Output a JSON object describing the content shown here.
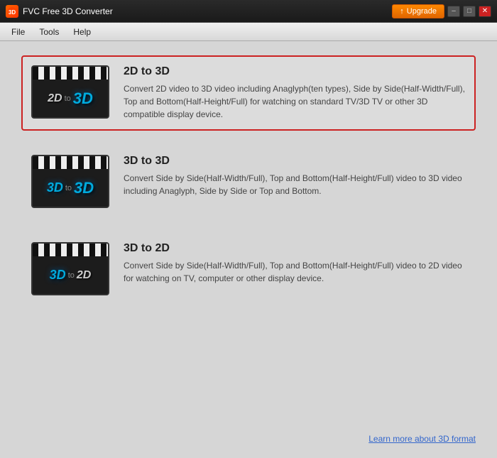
{
  "titleBar": {
    "appName": "FVC Free 3D Converter",
    "upgradeLabel": "Upgrade",
    "minBtn": "–",
    "maxBtn": "□",
    "closeBtn": "✕"
  },
  "menuBar": {
    "items": [
      "File",
      "Tools",
      "Help"
    ]
  },
  "options": [
    {
      "id": "2d-to-3d",
      "title": "2D to 3D",
      "description": "Convert 2D video to 3D video including Anaglyph(ten types), Side by Side(Half-Width/Full), Top and Bottom(Half-Height/Full) for watching on standard TV/3D TV or other 3D compatible display device.",
      "fromLabel": "2D",
      "toLabel": "3D",
      "selected": true
    },
    {
      "id": "3d-to-3d",
      "title": "3D to 3D",
      "description": "Convert Side by Side(Half-Width/Full), Top and Bottom(Half-Height/Full) video to 3D video including Anaglyph, Side by Side or Top and Bottom.",
      "fromLabel": "3D",
      "toLabel": "3D",
      "selected": false
    },
    {
      "id": "3d-to-2d",
      "title": "3D to 2D",
      "description": "Convert Side by Side(Half-Width/Full), Top and Bottom(Half-Height/Full) video to 2D video for watching on TV, computer or other display device.",
      "fromLabel": "3D",
      "toLabel": "2D",
      "selected": false
    }
  ],
  "bottomLink": "Learn more about 3D format"
}
